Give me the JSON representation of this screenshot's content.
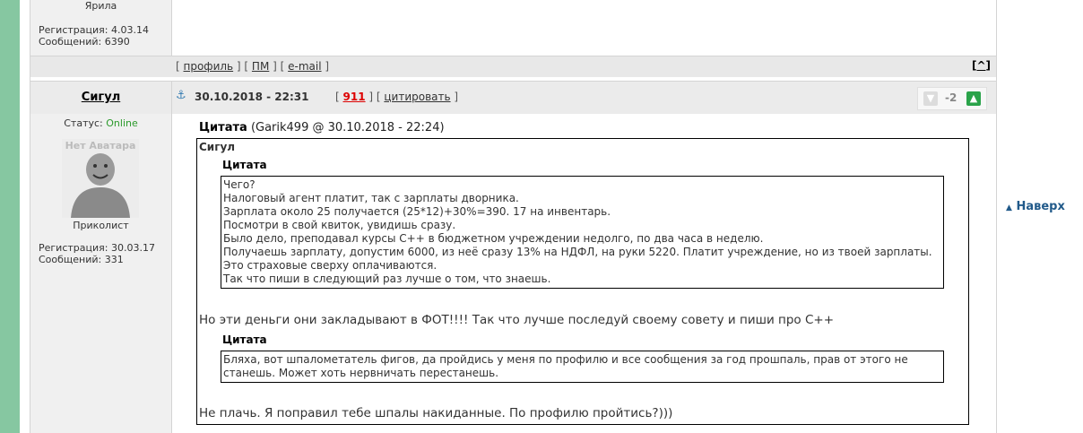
{
  "prev_post": {
    "author_name": "Ярила",
    "reg_label": "Регистрация:",
    "reg_value": "4.03.14",
    "msgs_label": "Сообщений:",
    "msgs_value": "6390",
    "links": {
      "profile": "профиль",
      "pm": "ПМ",
      "email": "e-mail"
    },
    "top_arrow": "^"
  },
  "post": {
    "author": "Сигул",
    "date": "30.10.2018 - 22:31",
    "post_number": "911",
    "quote_link": "цитировать",
    "vote": {
      "score": "-2"
    },
    "status_label": "Статус:",
    "status_value": "Online",
    "avatar_text": "Нет Аватара",
    "rank": "Приколист",
    "reg_label": "Регистрация:",
    "reg_value": "30.03.17",
    "msgs_label": "Сообщений:",
    "msgs_value": "331",
    "quote_header_label": "Цитата",
    "quote_header_meta": "(Garik499 @ 30.10.2018 - 22:24)",
    "outer_quote_author": "Сигул",
    "inner_quote_label": "Цитата",
    "inner_quote_lines": [
      "Чего?",
      "Налоговый агент платит, так с зарплаты дворника.",
      "Зарплата около 25 получается (25*12)+30%=390. 17 на инвентарь.",
      "Посмотри в свой квиток, увидишь сразу.",
      "Было дело, преподавал курсы С++ в бюджетном учреждении недолго, по два часа в неделю.",
      "Получаешь зарплату, допустим 6000, из неё сразу 13% на НДФЛ, на руки 5220. Платит учреждение, но из твоей зарплаты.",
      "Это страховые сверху оплачиваются.",
      "Так что пиши в следующий раз лучше о том, что знаешь."
    ],
    "reply_1": "Но эти деньги они закладывают в ФОТ!!!! Так что лучше последуй своему совету и пиши про С++",
    "second_quote_label": "Цитата",
    "second_quote_lines": [
      "Бляха, вот шпалометатель фигов, да пройдись у меня по профилю и все сообщения за год прошпаль, прав от этого не",
      "станешь. Может хоть нервничать перестанешь."
    ],
    "reply_2": "Не плачь. Я поправил тебе шпалы накиданные. По профилю пройтись?)))"
  },
  "side_nav": {
    "to_top": "Наверх"
  }
}
